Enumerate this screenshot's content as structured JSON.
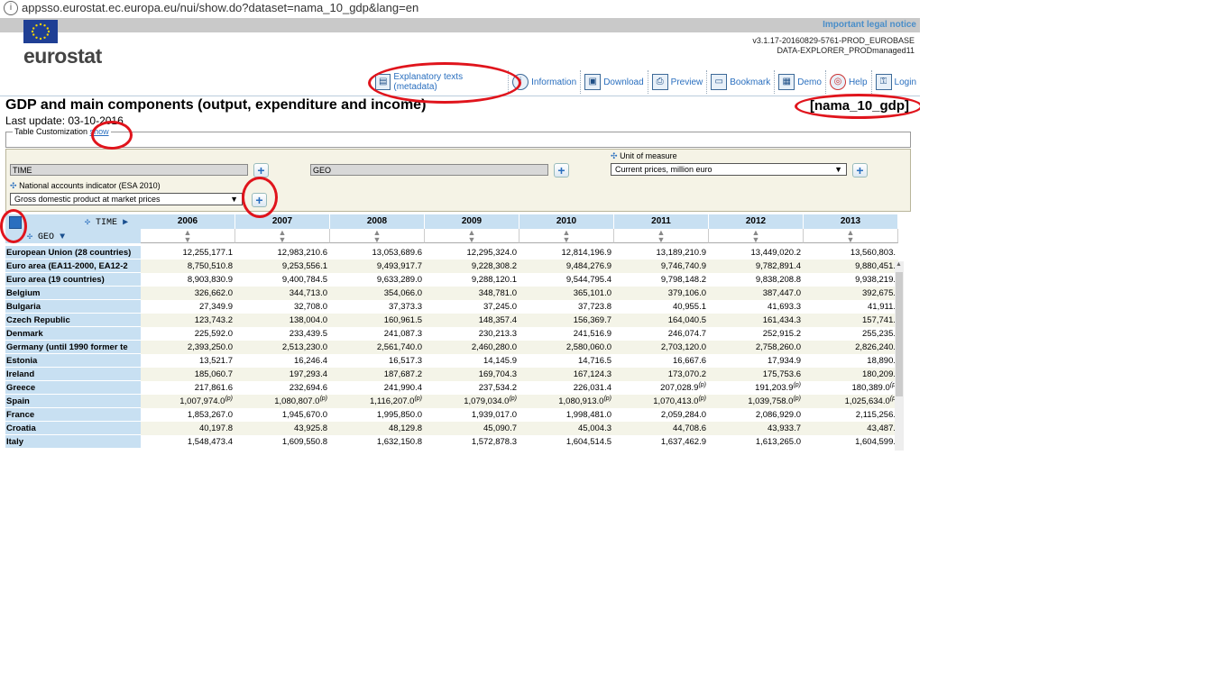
{
  "browser": {
    "url": "appsso.eurostat.ec.europa.eu/nui/show.do?dataset=nama_10_gdp&lang=en"
  },
  "header": {
    "legal_notice": "Important legal notice",
    "logo": "eurostat",
    "version_line1": "v3.1.17-20160829-5761-PROD_EUROBASE",
    "version_line2": "DATA-EXPLORER_PRODmanaged11"
  },
  "toolbar": {
    "metadata": "Explanatory texts (metadata)",
    "information": "Information",
    "download": "Download",
    "preview": "Preview",
    "bookmark": "Bookmark",
    "demo": "Demo",
    "help": "Help",
    "login": "Login"
  },
  "page": {
    "title": "GDP and main components (output, expenditure and income)",
    "dataset_code": "[nama_10_gdp]",
    "last_update": "Last update: 03-10-2016",
    "customization_label": "Table Customization",
    "customization_link": "show"
  },
  "dimensions": {
    "time": "TIME",
    "geo": "GEO",
    "unit_label": "Unit of measure",
    "unit_value": "Current prices, million euro",
    "indicator_label": "National accounts indicator (ESA 2010)",
    "indicator_value": "Gross domestic product at market prices"
  },
  "table": {
    "corner_time": "TIME",
    "corner_geo": "GEO",
    "years": [
      "2006",
      "2007",
      "2008",
      "2009",
      "2010",
      "2011",
      "2012",
      "2013"
    ],
    "rows": [
      {
        "label": "European Union (28 countries)",
        "values": [
          "12,255,177.1",
          "12,983,210.6",
          "13,053,689.6",
          "12,295,324.0",
          "12,814,196.9",
          "13,189,210.9",
          "13,449,020.2",
          "13,560,803."
        ],
        "flags": [
          "",
          "",
          "",
          "",
          "",
          "",
          "",
          ""
        ]
      },
      {
        "label": "Euro area (EA11-2000, EA12-2",
        "values": [
          "8,750,510.8",
          "9,253,556.1",
          "9,493,917.7",
          "9,228,308.2",
          "9,484,276.9",
          "9,746,740.9",
          "9,782,891.4",
          "9,880,451."
        ],
        "flags": [
          "",
          "",
          "",
          "",
          "",
          "",
          "",
          ""
        ]
      },
      {
        "label": "Euro area (19 countries)",
        "values": [
          "8,903,830.9",
          "9,400,784.5",
          "9,633,289.0",
          "9,288,120.1",
          "9,544,795.4",
          "9,798,148.2",
          "9,838,208.8",
          "9,938,219."
        ],
        "flags": [
          "",
          "",
          "",
          "",
          "",
          "",
          "",
          ""
        ]
      },
      {
        "label": "Belgium",
        "values": [
          "326,662.0",
          "344,713.0",
          "354,066.0",
          "348,781.0",
          "365,101.0",
          "379,106.0",
          "387,447.0",
          "392,675."
        ],
        "flags": [
          "",
          "",
          "",
          "",
          "",
          "",
          "",
          ""
        ]
      },
      {
        "label": "Bulgaria",
        "values": [
          "27,349.9",
          "32,708.0",
          "37,373.3",
          "37,245.0",
          "37,723.8",
          "40,955.1",
          "41,693.3",
          "41,911."
        ],
        "flags": [
          "",
          "",
          "",
          "",
          "",
          "",
          "",
          ""
        ]
      },
      {
        "label": "Czech Republic",
        "values": [
          "123,743.2",
          "138,004.0",
          "160,961.5",
          "148,357.4",
          "156,369.7",
          "164,040.5",
          "161,434.3",
          "157,741."
        ],
        "flags": [
          "",
          "",
          "",
          "",
          "",
          "",
          "",
          ""
        ]
      },
      {
        "label": "Denmark",
        "values": [
          "225,592.0",
          "233,439.5",
          "241,087.3",
          "230,213.3",
          "241,516.9",
          "246,074.7",
          "252,915.2",
          "255,235."
        ],
        "flags": [
          "",
          "",
          "",
          "",
          "",
          "",
          "",
          ""
        ]
      },
      {
        "label": "Germany (until 1990 former te",
        "values": [
          "2,393,250.0",
          "2,513,230.0",
          "2,561,740.0",
          "2,460,280.0",
          "2,580,060.0",
          "2,703,120.0",
          "2,758,260.0",
          "2,826,240."
        ],
        "flags": [
          "",
          "",
          "",
          "",
          "",
          "",
          "",
          ""
        ]
      },
      {
        "label": "Estonia",
        "values": [
          "13,521.7",
          "16,246.4",
          "16,517.3",
          "14,145.9",
          "14,716.5",
          "16,667.6",
          "17,934.9",
          "18,890."
        ],
        "flags": [
          "",
          "",
          "",
          "",
          "",
          "",
          "",
          ""
        ]
      },
      {
        "label": "Ireland",
        "values": [
          "185,060.7",
          "197,293.4",
          "187,687.2",
          "169,704.3",
          "167,124.3",
          "173,070.2",
          "175,753.6",
          "180,209."
        ],
        "flags": [
          "",
          "",
          "",
          "",
          "",
          "",
          "",
          ""
        ]
      },
      {
        "label": "Greece",
        "values": [
          "217,861.6",
          "232,694.6",
          "241,990.4",
          "237,534.2",
          "226,031.4",
          "207,028.9",
          "191,203.9",
          "180,389.0"
        ],
        "flags": [
          "",
          "",
          "",
          "",
          "",
          "(p)",
          "(p)",
          "(p"
        ]
      },
      {
        "label": "Spain",
        "values": [
          "1,007,974.0",
          "1,080,807.0",
          "1,116,207.0",
          "1,079,034.0",
          "1,080,913.0",
          "1,070,413.0",
          "1,039,758.0",
          "1,025,634.0"
        ],
        "flags": [
          "(p)",
          "(p)",
          "(p)",
          "(p)",
          "(p)",
          "(p)",
          "(p)",
          "(p"
        ]
      },
      {
        "label": "France",
        "values": [
          "1,853,267.0",
          "1,945,670.0",
          "1,995,850.0",
          "1,939,017.0",
          "1,998,481.0",
          "2,059,284.0",
          "2,086,929.0",
          "2,115,256."
        ],
        "flags": [
          "",
          "",
          "",
          "",
          "",
          "",
          "",
          ""
        ]
      },
      {
        "label": "Croatia",
        "values": [
          "40,197.8",
          "43,925.8",
          "48,129.8",
          "45,090.7",
          "45,004.3",
          "44,708.6",
          "43,933.7",
          "43,487."
        ],
        "flags": [
          "",
          "",
          "",
          "",
          "",
          "",
          "",
          ""
        ]
      },
      {
        "label": "Italy",
        "values": [
          "1,548,473.4",
          "1,609,550.8",
          "1,632,150.8",
          "1,572,878.3",
          "1,604,514.5",
          "1,637,462.9",
          "1,613,265.0",
          "1,604,599."
        ],
        "flags": [
          "",
          "",
          "",
          "",
          "",
          "",
          "",
          ""
        ]
      }
    ]
  }
}
